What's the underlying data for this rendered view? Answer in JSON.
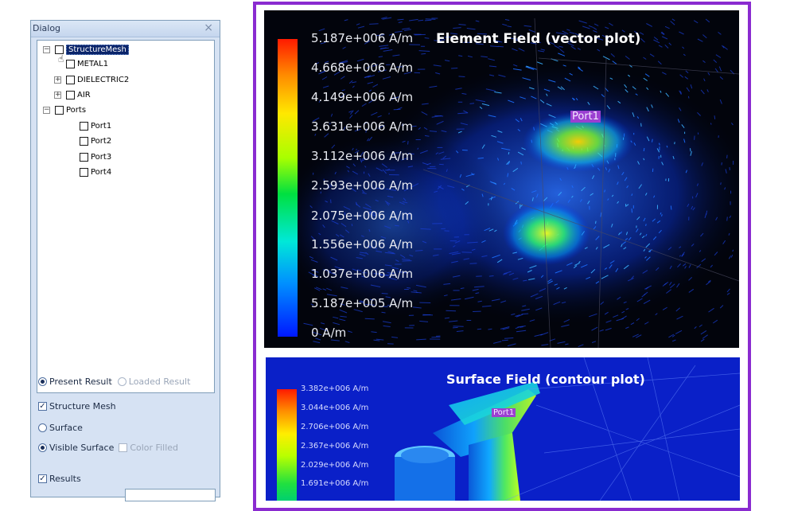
{
  "dialog": {
    "title": "Dialog",
    "close_glyph": "×",
    "tree": [
      {
        "label": "StructureMesh",
        "expander": "⊟",
        "selected": true,
        "indent": 0
      },
      {
        "label": "METAL1",
        "expander": "⊞",
        "indent": 1
      },
      {
        "label": "DIELECTRIC2",
        "expander": "⊞",
        "indent": 1
      },
      {
        "label": "AIR",
        "expander": "⊞",
        "indent": 1
      },
      {
        "label": "Ports",
        "expander": "⊟",
        "indent": 0
      },
      {
        "label": "Port1",
        "indent": 2
      },
      {
        "label": "Port2",
        "indent": 2
      },
      {
        "label": "Port3",
        "indent": 2
      },
      {
        "label": "Port4",
        "indent": 2
      }
    ],
    "options": {
      "present_result": "Present Result",
      "loaded_result": "Loaded Result",
      "structure_mesh": "Structure Mesh",
      "surface": "Surface",
      "visible_surface": "Visible Surface",
      "color_filled": "Color Filled",
      "results": "Results"
    }
  },
  "plots": {
    "vector": {
      "title": "Element Field (vector plot)",
      "port_tag": "Port1",
      "legend": [
        "5.187e+006 A/m",
        "4.668e+006 A/m",
        "4.149e+006 A/m",
        "3.631e+006 A/m",
        "3.112e+006 A/m",
        "2.593e+006 A/m",
        "2.075e+006 A/m",
        "1.556e+006 A/m",
        "1.037e+006 A/m",
        "5.187e+005 A/m",
        "0 A/m"
      ]
    },
    "contour": {
      "title": "Surface Field (contour plot)",
      "port_tag": "Port1",
      "legend": [
        "3.382e+006 A/m",
        "3.044e+006 A/m",
        "2.706e+006 A/m",
        "2.367e+006 A/m",
        "2.029e+006 A/m",
        "1.691e+006 A/m"
      ]
    }
  },
  "colors": {
    "frame": "#8a2bd0",
    "selection": "#0a246a",
    "port_tag": "#9b3fd1"
  }
}
